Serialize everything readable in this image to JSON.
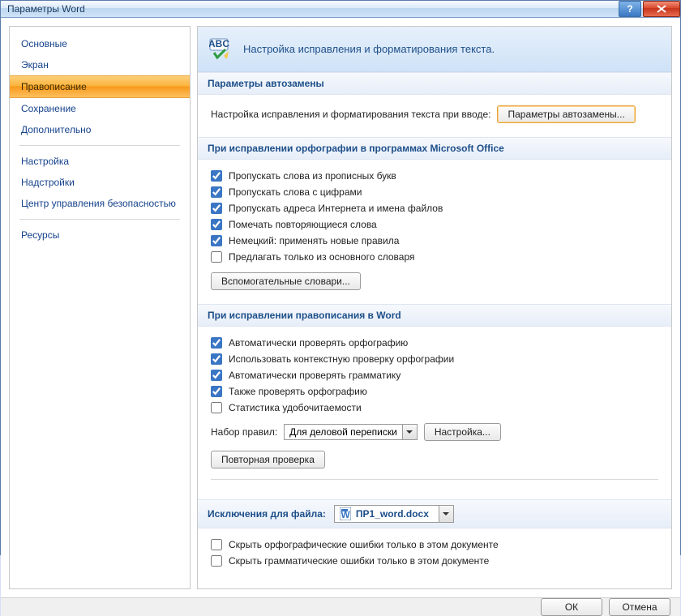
{
  "window": {
    "title": "Параметры Word"
  },
  "sidebar": {
    "top": [
      {
        "label": "Основные"
      },
      {
        "label": "Экран"
      },
      {
        "label": "Правописание",
        "selected": true
      },
      {
        "label": "Сохранение"
      },
      {
        "label": "Дополнительно"
      }
    ],
    "mid": [
      {
        "label": "Настройка"
      },
      {
        "label": "Надстройки"
      },
      {
        "label": "Центр управления безопасностью"
      }
    ],
    "bot": [
      {
        "label": "Ресурсы"
      }
    ]
  },
  "banner": {
    "text": "Настройка исправления и форматирования текста."
  },
  "group_autocorrect": {
    "title": "Параметры автозамены",
    "desc": "Настройка исправления и форматирования текста при вводе:",
    "button": "Параметры автозамены..."
  },
  "group_office": {
    "title": "При исправлении орфографии в программах Microsoft Office",
    "ck1": "Пропускать слова из прописных букв",
    "ck2": "Пропускать слова с цифрами",
    "ck3": "Пропускать адреса Интернета и имена файлов",
    "ck4": "Помечать повторяющиеся слова",
    "ck5": "Немецкий: применять новые правила",
    "ck6": "Предлагать только из основного словаря",
    "dict_btn": "Вспомогательные словари..."
  },
  "group_word": {
    "title": "При исправлении правописания в Word",
    "ck1": "Автоматически проверять орфографию",
    "ck2": "Использовать контекстную проверку орфографии",
    "ck3": "Автоматически проверять грамматику",
    "ck4": "Также проверять орфографию",
    "ck5": "Статистика удобочитаемости",
    "ruleset_label": "Набор правил:",
    "ruleset_value": "Для деловой переписки",
    "settings_btn": "Настройка...",
    "recheck_btn": "Повторная проверка"
  },
  "group_exceptions": {
    "title": "Исключения для файла:",
    "file_value": "ПР1_word.docx",
    "ck1": "Скрыть орфографические ошибки только в этом документе",
    "ck2": "Скрыть грамматические ошибки только в этом документе"
  },
  "footer": {
    "ok": "ОК",
    "cancel": "Отмена"
  }
}
